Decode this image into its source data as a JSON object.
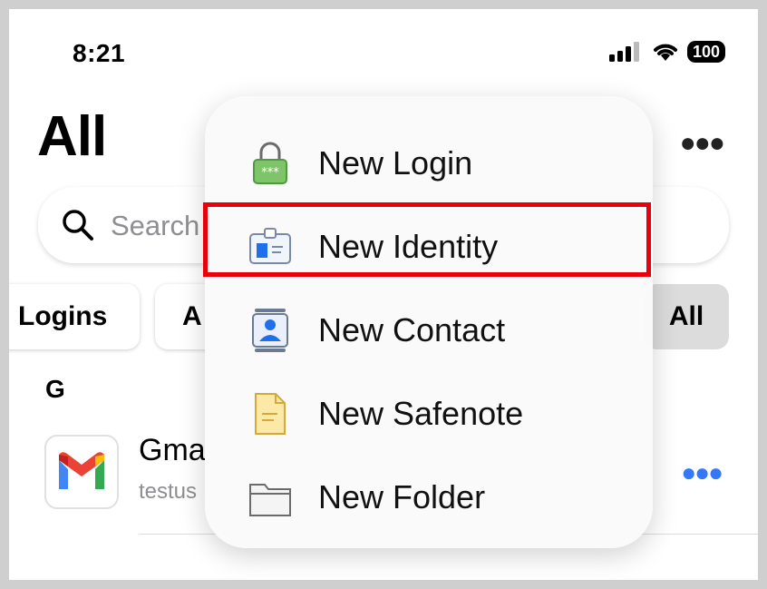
{
  "status": {
    "time": "8:21",
    "battery": "100"
  },
  "header": {
    "title": "All"
  },
  "search": {
    "placeholder": "Search"
  },
  "chips": [
    {
      "label": "Logins"
    },
    {
      "label": "A"
    },
    {
      "label": "All"
    }
  ],
  "list": {
    "section": "G",
    "items": [
      {
        "title": "Gma",
        "subtitle": "testus"
      }
    ]
  },
  "menu": {
    "items": [
      {
        "label": "New Login",
        "icon": "lock-icon"
      },
      {
        "label": "New Identity",
        "icon": "id-card-icon"
      },
      {
        "label": "New Contact",
        "icon": "contact-icon"
      },
      {
        "label": "New Safenote",
        "icon": "note-icon"
      },
      {
        "label": "New Folder",
        "icon": "folder-icon"
      }
    ],
    "highlighted": "New Identity"
  },
  "colors": {
    "accent": "#3478f6",
    "highlight": "#e8000b"
  }
}
